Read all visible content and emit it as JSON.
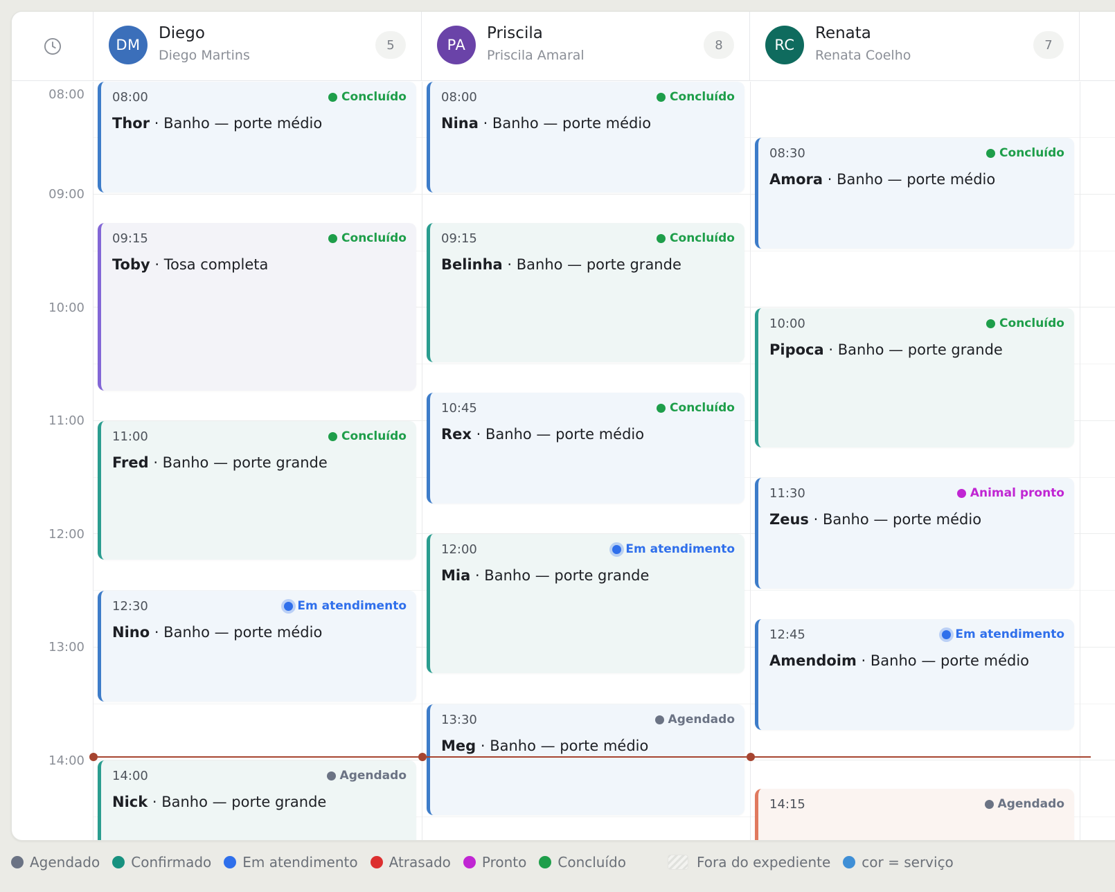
{
  "header": {
    "clock_icon": "clock-icon",
    "columns": [
      {
        "initials": "DM",
        "name": "Diego",
        "full_name": "Diego Martins",
        "count": "5",
        "avatar_color": "#3b6fba"
      },
      {
        "initials": "PA",
        "name": "Priscila",
        "full_name": "Priscila Amaral",
        "count": "8",
        "avatar_color": "#6a43a8"
      },
      {
        "initials": "RC",
        "name": "Renata",
        "full_name": "Renata Coelho",
        "count": "7",
        "avatar_color": "#0f6b5e"
      }
    ]
  },
  "times": [
    "08:00",
    "09:00",
    "10:00",
    "11:00",
    "12:00",
    "13:00",
    "14:00"
  ],
  "colors": {
    "bath_medium": "#3d7cc9",
    "bath_large": "#2a9d8f",
    "grooming": "#8266d6",
    "other": "#e07a5f",
    "status_done": "#1e9e4a",
    "status_in_progress": "#2f6feb",
    "status_ready": "#c026d3",
    "status_scheduled": "#6b7384",
    "now_line": "#a64430"
  },
  "appointments": {
    "diego": [
      {
        "time": "08:00",
        "pet": "Thor",
        "service": " · Banho — porte médio",
        "status": "Concluído"
      },
      {
        "time": "09:15",
        "pet": "Toby",
        "service": " · Tosa completa",
        "status": "Concluído"
      },
      {
        "time": "11:00",
        "pet": "Fred",
        "service": " · Banho — porte grande",
        "status": "Concluído"
      },
      {
        "time": "12:30",
        "pet": "Nino",
        "service": " · Banho — porte médio",
        "status": "Em atendimento"
      },
      {
        "time": "14:00",
        "pet": "Nick",
        "service": " · Banho — porte grande",
        "status": "Agendado"
      }
    ],
    "priscila": [
      {
        "time": "08:00",
        "pet": "Nina",
        "service": " · Banho — porte médio",
        "status": "Concluído"
      },
      {
        "time": "09:15",
        "pet": "Belinha",
        "service": " · Banho — porte grande",
        "status": "Concluído"
      },
      {
        "time": "10:45",
        "pet": "Rex",
        "service": " · Banho — porte médio",
        "status": "Concluído"
      },
      {
        "time": "12:00",
        "pet": "Mia",
        "service": " · Banho — porte grande",
        "status": "Em atendimento"
      },
      {
        "time": "13:30",
        "pet": "Meg",
        "service": " · Banho — porte médio",
        "status": "Agendado"
      }
    ],
    "renata": [
      {
        "time": "08:30",
        "pet": "Amora",
        "service": " · Banho — porte médio",
        "status": "Concluído"
      },
      {
        "time": "10:00",
        "pet": "Pipoca",
        "service": " · Banho — porte grande",
        "status": "Concluído"
      },
      {
        "time": "11:30",
        "pet": "Zeus",
        "service": " · Banho — porte médio",
        "status": "Animal pronto"
      },
      {
        "time": "12:45",
        "pet": "Amendoim",
        "service": " · Banho — porte médio",
        "status": "Em atendimento"
      },
      {
        "time": "14:15",
        "status": "Agendado"
      }
    ]
  },
  "legend": [
    {
      "label": "Agendado",
      "color": "#6b7384"
    },
    {
      "label": "Confirmado",
      "color": "#17917f"
    },
    {
      "label": "Em atendimento",
      "color": "#2f6feb"
    },
    {
      "label": "Atrasado",
      "color": "#dc2f2f"
    },
    {
      "label": "Pronto",
      "color": "#c026d3"
    },
    {
      "label": "Concluído",
      "color": "#1e9e4a"
    },
    {
      "label": "Fora do expediente"
    },
    {
      "label": "cor = serviço",
      "color": "#3f8fd6"
    }
  ]
}
